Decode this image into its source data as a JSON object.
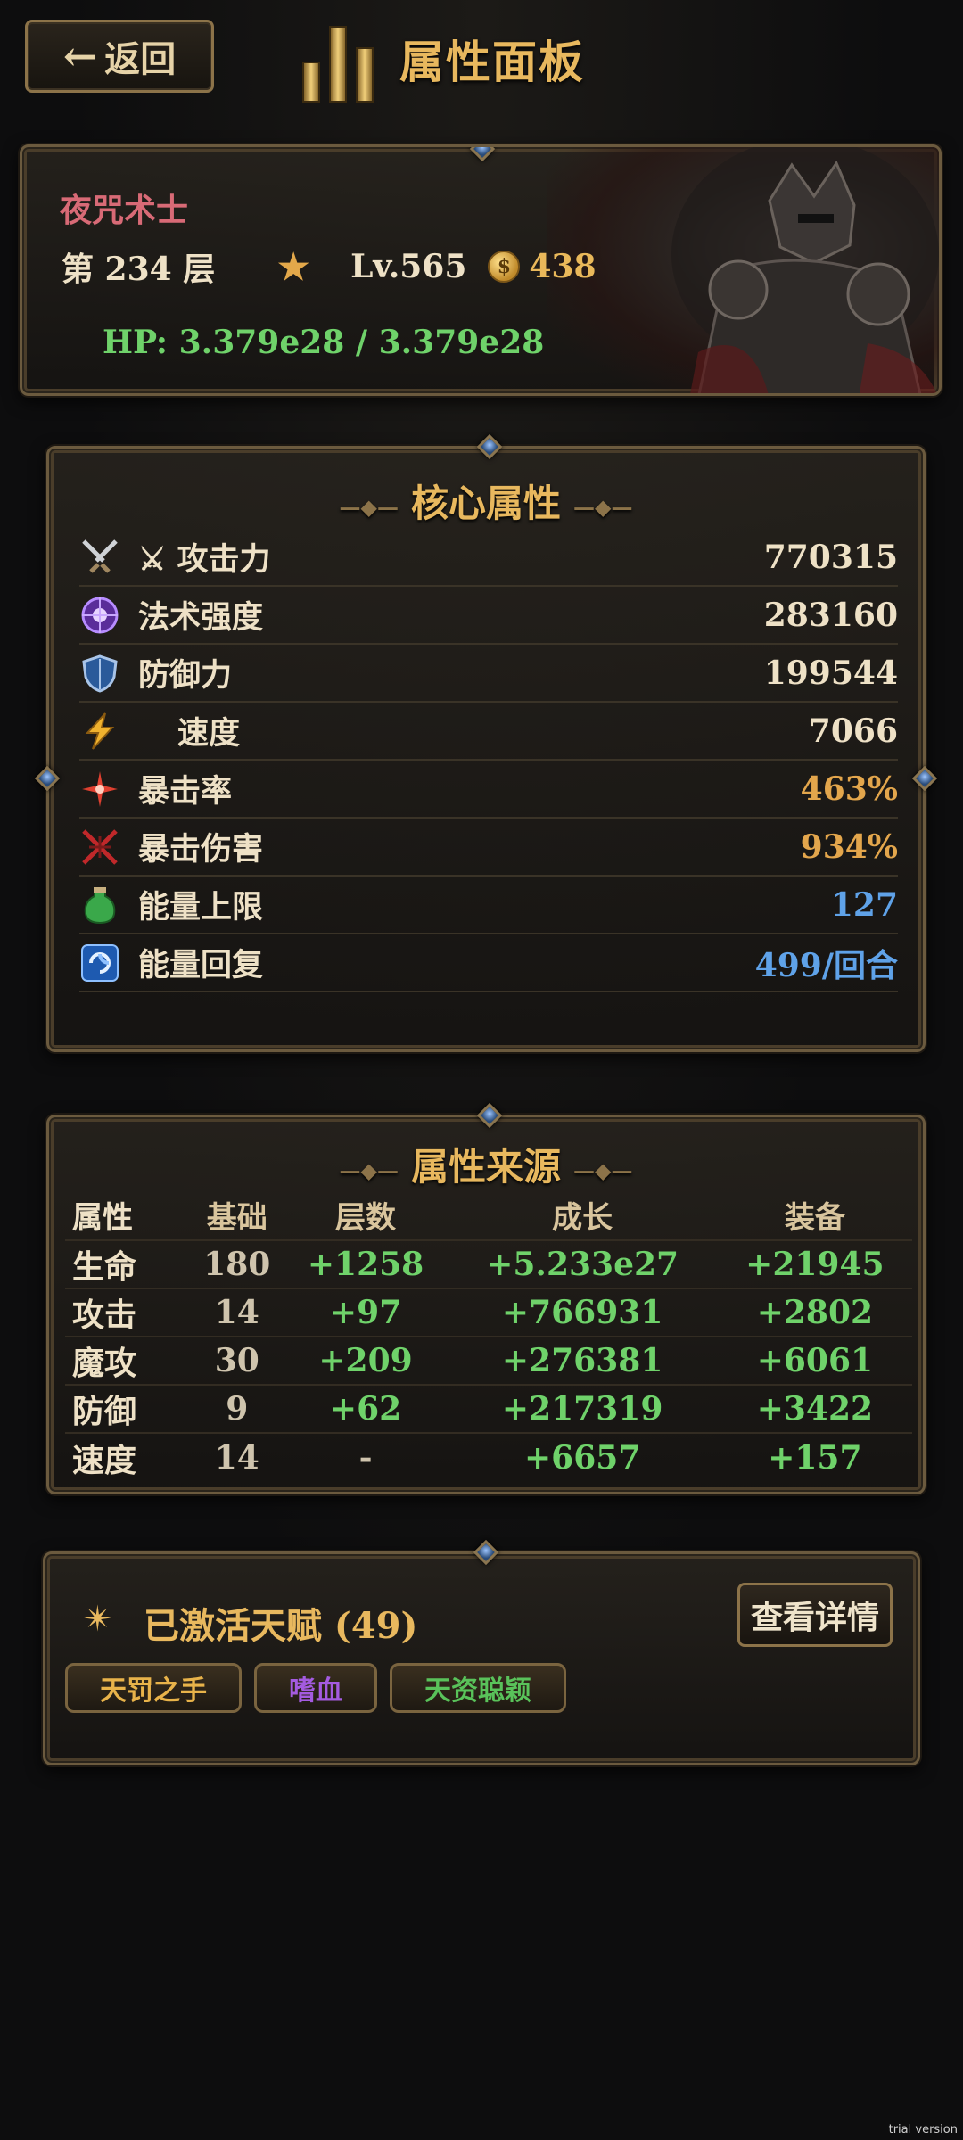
{
  "header": {
    "back_label": "返回",
    "title": "属性面板"
  },
  "character": {
    "name": "夜咒术士",
    "floor": "第 234 层",
    "level": "Lv.565",
    "gold": "438",
    "hp": "HP: 3.379e28 / 3.379e28"
  },
  "core": {
    "title": "核心属性",
    "rows": [
      {
        "icon": "crossed-swords-icon",
        "label": "⚔ 攻击力",
        "value": "770315",
        "tone": "white"
      },
      {
        "icon": "magic-orb-icon",
        "label": "法术强度",
        "value": "283160",
        "tone": "white"
      },
      {
        "icon": "shield-icon",
        "label": "防御力",
        "value": "199544",
        "tone": "white"
      },
      {
        "icon": "lightning-icon",
        "label": "速度",
        "value": "7066",
        "tone": "white"
      },
      {
        "icon": "crit-burst-icon",
        "label": "暴击率",
        "value": "463%",
        "tone": "gold"
      },
      {
        "icon": "crit-damage-icon",
        "label": "暴击伤害",
        "value": "934%",
        "tone": "gold"
      },
      {
        "icon": "energy-potion-icon",
        "label": "能量上限",
        "value": "127",
        "tone": "blue"
      },
      {
        "icon": "energy-swirl-icon",
        "label": "能量回复",
        "value": "499/回合",
        "tone": "blue"
      }
    ]
  },
  "source": {
    "title": "属性来源",
    "headers": [
      "属性",
      "基础",
      "层数",
      "成长",
      "装备"
    ],
    "rows": [
      [
        "生命",
        "180",
        "+1258",
        "+5.233e27",
        "+21945"
      ],
      [
        "攻击",
        "14",
        "+97",
        "+766931",
        "+2802"
      ],
      [
        "魔攻",
        "30",
        "+209",
        "+276381",
        "+6061"
      ],
      [
        "防御",
        "9",
        "+62",
        "+217319",
        "+3422"
      ],
      [
        "速度",
        "14",
        "-",
        "+6657",
        "+157"
      ]
    ]
  },
  "talent": {
    "title": "已激活天赋 (49)",
    "detail_label": "查看详情",
    "tags": [
      {
        "label": "天罚之手",
        "color": "#e8b34a"
      },
      {
        "label": "嗜血",
        "color": "#a45be0"
      },
      {
        "label": "天资聪颖",
        "color": "#59c25a"
      }
    ]
  },
  "colors": {
    "accent_gold": "#e8b85e",
    "hp_green": "#6fd26a",
    "value_blue": "#5fa2e8",
    "name_pink": "#d86a76"
  },
  "watermark": "trial version"
}
